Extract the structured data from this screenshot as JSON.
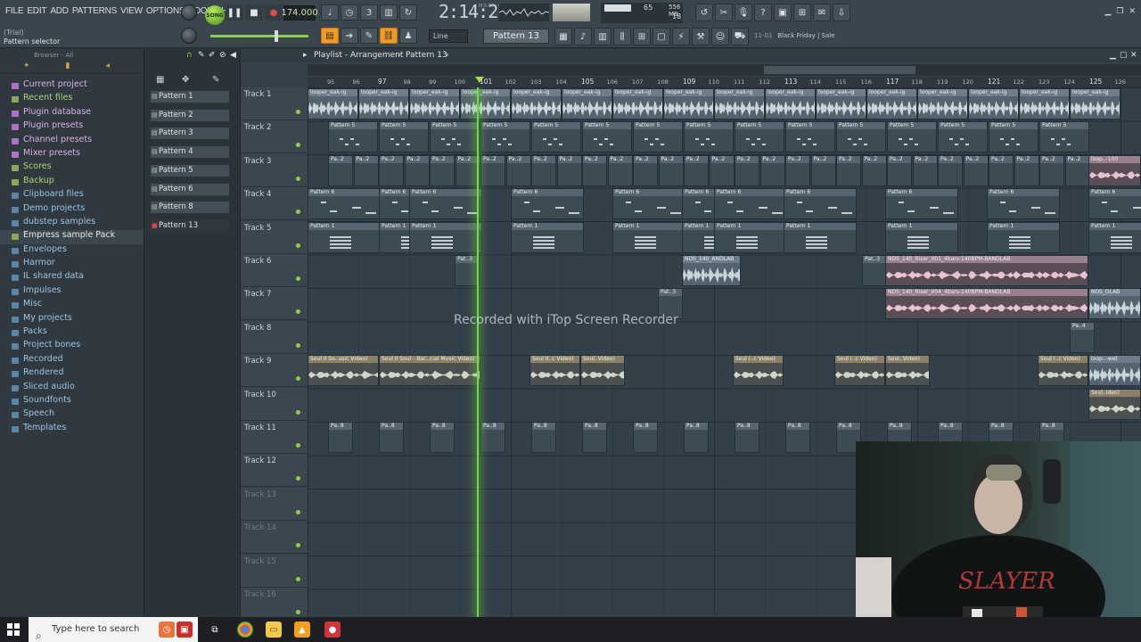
{
  "menu": [
    "FILE",
    "EDIT",
    "ADD",
    "PATTERNS",
    "VIEW",
    "OPTIONS",
    "TOOLS",
    "HELP"
  ],
  "status": {
    "trial": "(Trial)",
    "hint": "Pattern selector"
  },
  "transport": {
    "song_label": "SONG",
    "tempo": "174.000",
    "time": "2:14:27",
    "time_unit": "M:S:CS"
  },
  "monitor": {
    "cpu": "65",
    "mem": "556 MB",
    "voices": "18"
  },
  "toolbar": {
    "snap": "Line",
    "pattern": "Pattern 13"
  },
  "news": {
    "time": "11-01",
    "text": "Black Friday | Sale"
  },
  "browser": {
    "header": "Browser - All",
    "items": [
      {
        "label": "Current project",
        "style": "pink"
      },
      {
        "label": "Recent files",
        "style": "green"
      },
      {
        "label": "Plugin database",
        "style": "pink"
      },
      {
        "label": "Plugin presets",
        "style": "pink"
      },
      {
        "label": "Channel presets",
        "style": "pink"
      },
      {
        "label": "Mixer presets",
        "style": "pink"
      },
      {
        "label": "Scores",
        "style": "green"
      },
      {
        "label": "Backup",
        "style": "green"
      },
      {
        "label": "Clipboard files",
        "style": "blue"
      },
      {
        "label": "Demo projects",
        "style": "blue"
      },
      {
        "label": "dubstep samples",
        "style": "blue"
      },
      {
        "label": "Empress sample Pack",
        "style": "sel"
      },
      {
        "label": "Envelopes",
        "style": "blue"
      },
      {
        "label": "Harmor",
        "style": "blue"
      },
      {
        "label": "IL shared data",
        "style": "blue"
      },
      {
        "label": "Impulses",
        "style": "blue"
      },
      {
        "label": "Misc",
        "style": "blue"
      },
      {
        "label": "My projects",
        "style": "blue"
      },
      {
        "label": "Packs",
        "style": "blue"
      },
      {
        "label": "Project bones",
        "style": "blue"
      },
      {
        "label": "Recorded",
        "style": "blue"
      },
      {
        "label": "Rendered",
        "style": "blue"
      },
      {
        "label": "Sliced audio",
        "style": "blue"
      },
      {
        "label": "Soundfonts",
        "style": "blue"
      },
      {
        "label": "Speech",
        "style": "blue"
      },
      {
        "label": "Templates",
        "style": "blue"
      }
    ]
  },
  "patterns": [
    "Pattern 1",
    "Pattern 2",
    "Pattern 3",
    "Pattern 4",
    "Pattern 5",
    "Pattern 6",
    "Pattern 8",
    "Pattern 13"
  ],
  "current_pattern_index": 7,
  "playlist": {
    "title": "Playlist - Arrangement",
    "crumb": "Pattern 13",
    "tracks": [
      "Track 1",
      "Track 2",
      "Track 3",
      "Track 4",
      "Track 5",
      "Track 6",
      "Track 7",
      "Track 8",
      "Track 9",
      "Track 10",
      "Track 11",
      "Track 12",
      "Track 13",
      "Track 14",
      "Track 15",
      "Track 16"
    ],
    "ruler": [
      "95",
      "96",
      "97",
      "98",
      "99",
      "100",
      "101",
      "102",
      "103",
      "104",
      "105",
      "106",
      "107",
      "108",
      "109",
      "110",
      "111",
      "112",
      "113",
      "114",
      "115",
      "116",
      "117",
      "118",
      "119",
      "120",
      "121",
      "122",
      "123",
      "124",
      "125",
      "126"
    ],
    "major_bars": [
      "97",
      "101",
      "105",
      "109",
      "113",
      "117",
      "121",
      "125"
    ],
    "clips": {
      "loop": "looper_eak-ig",
      "p5": "Pattern 5",
      "p2": "Pa..2",
      "p6": "Pattern 6",
      "p1": "Pattern 1",
      "p8": "Pa..8",
      "pat3": "Pat..3",
      "andlab": "NDS_140_ANDLAB",
      "riser1": "NDS_140_Riser_001_4bars-140BPM-BANDLAB",
      "riser4": "NDS_140_Riser_004_4bars-140BPM-BANDLAB",
      "dlab": "NDS_DLAB",
      "pa4": "Pa..4",
      "soul1": "Soul II So..usic Video)",
      "soul2": "Soul II Soul - Bac..cial Music Video)",
      "soul3": "Soul II..c Video)",
      "soul4": "Soul..Video)",
      "soul5": "Soul I..c Video)",
      "soul6": "Soul..Video)",
      "loopwet": "loop..-wet",
      "souldeo": "Soul..ideo)",
      "loop100": "loop..-100"
    }
  },
  "watermark": "Recorded with iTop Screen Recorder",
  "taskbar": {
    "search_placeholder": "Type here to search"
  }
}
